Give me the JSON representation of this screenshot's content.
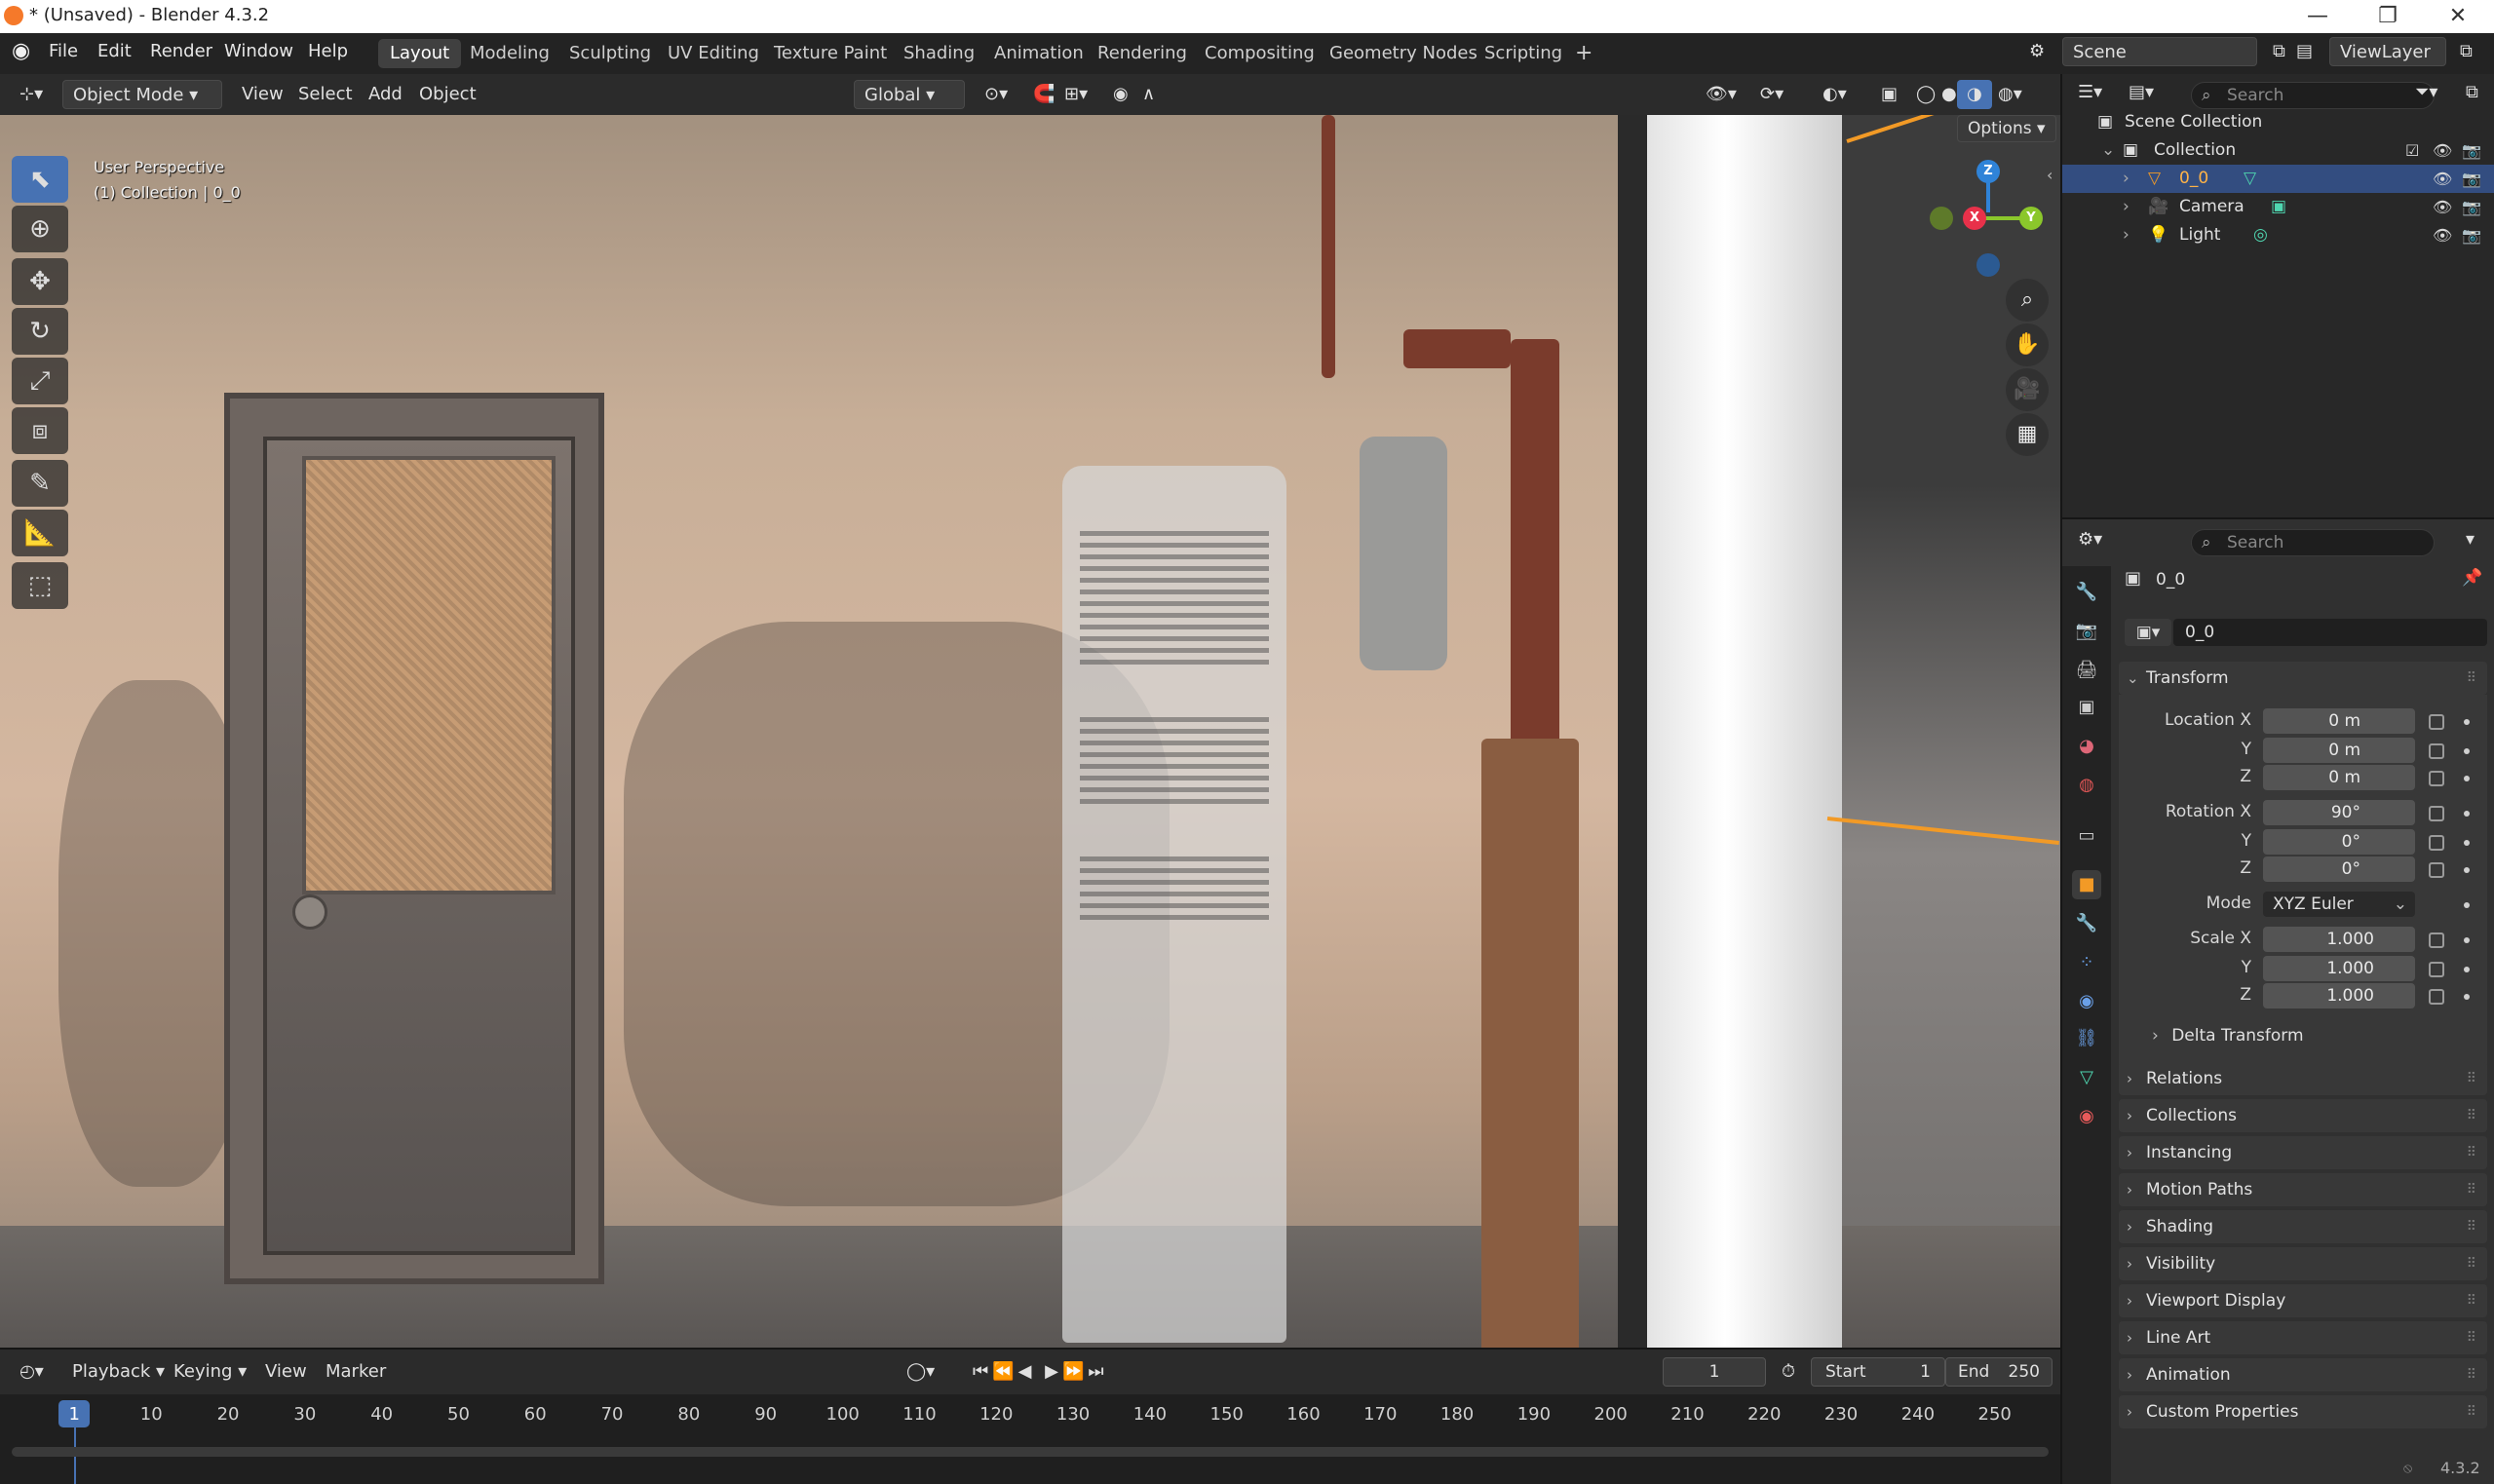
{
  "window": {
    "title": "* (Unsaved) - Blender 4.3.2",
    "minimize": "—",
    "maximize": "❐",
    "close": "✕"
  },
  "menu": {
    "file": "File",
    "edit": "Edit",
    "render": "Render",
    "window": "Window",
    "help": "Help"
  },
  "workspaces": [
    "Layout",
    "Modeling",
    "Sculpting",
    "UV Editing",
    "Texture Paint",
    "Shading",
    "Animation",
    "Rendering",
    "Compositing",
    "Geometry Nodes",
    "Scripting"
  ],
  "workspace_add": "+",
  "scene": {
    "name": "Scene",
    "view_layer": "ViewLayer"
  },
  "viewport_header": {
    "mode": "Object Mode",
    "view": "View",
    "select": "Select",
    "add": "Add",
    "object": "Object",
    "orientation": "Global",
    "options": "Options"
  },
  "viewport": {
    "perspective": "User Perspective",
    "collection_info": "(1) Collection | 0_0",
    "gizmo": {
      "x": "X",
      "y": "Y",
      "z": "Z"
    }
  },
  "toolbar": [
    "select-box",
    "cursor",
    "move",
    "rotate",
    "scale",
    "transform",
    "annotate",
    "measure",
    "add-cube"
  ],
  "timeline": {
    "playback": "Playback",
    "keying": "Keying",
    "view": "View",
    "marker": "Marker",
    "current_frame": "1",
    "start_label": "Start",
    "start": "1",
    "end_label": "End",
    "end": "250",
    "ruler": [
      "1",
      "10",
      "20",
      "30",
      "40",
      "50",
      "60",
      "70",
      "80",
      "90",
      "100",
      "110",
      "120",
      "130",
      "140",
      "150",
      "160",
      "170",
      "180",
      "190",
      "200",
      "210",
      "220",
      "230",
      "240",
      "250"
    ]
  },
  "outliner": {
    "search_placeholder": "Search",
    "scene_collection": "Scene Collection",
    "collection": "Collection",
    "items": [
      {
        "name": "0_0"
      },
      {
        "name": "Camera"
      },
      {
        "name": "Light"
      }
    ]
  },
  "properties": {
    "search_placeholder": "Search",
    "object_name": "0_0",
    "object_field": "0_0",
    "transform": {
      "header": "Transform",
      "location_label": "Location X",
      "location": [
        "0 m",
        "0 m",
        "0 m"
      ],
      "rotation_label": "Rotation X",
      "rotation": [
        "90°",
        "0°",
        "0°"
      ],
      "mode_label": "Mode",
      "mode": "XYZ Euler",
      "scale_label": "Scale X",
      "scale": [
        "1.000",
        "1.000",
        "1.000"
      ],
      "y": "Y",
      "z": "Z",
      "delta": "Delta Transform"
    },
    "panels": [
      "Relations",
      "Collections",
      "Instancing",
      "Motion Paths",
      "Shading",
      "Visibility",
      "Viewport Display",
      "Line Art",
      "Animation",
      "Custom Properties"
    ]
  },
  "status": {
    "version": "4.3.2"
  },
  "colors": {
    "accent": "#4772b3",
    "selected": "#334d80",
    "x_axis": "#e8314a",
    "y_axis": "#8bc72b",
    "z_axis": "#2f83d8"
  }
}
